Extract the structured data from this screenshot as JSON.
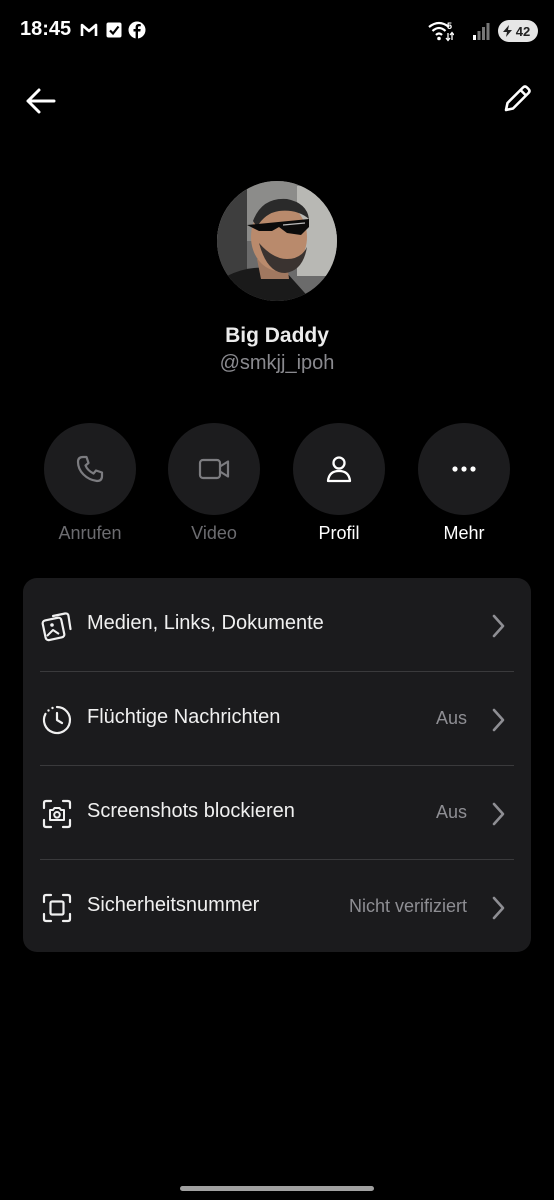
{
  "status_bar": {
    "time": "18:45",
    "battery": "42",
    "network": "5"
  },
  "contact": {
    "name": "Big Daddy",
    "handle": "@smkjj_ipoh"
  },
  "actions": [
    {
      "label": "Anrufen",
      "enabled": false,
      "icon": "phone-icon"
    },
    {
      "label": "Video",
      "enabled": false,
      "icon": "video-icon"
    },
    {
      "label": "Profil",
      "enabled": true,
      "icon": "person-icon"
    },
    {
      "label": "Mehr",
      "enabled": true,
      "icon": "more-icon"
    }
  ],
  "settings": [
    {
      "label": "Medien, Links, Dokumente",
      "value": "",
      "icon": "media-gallery-icon"
    },
    {
      "label": "Flüchtige Nachrichten",
      "value": "Aus",
      "icon": "timer-icon"
    },
    {
      "label": "Screenshots blockieren",
      "value": "Aus",
      "icon": "screenshot-camera-icon"
    },
    {
      "label": "Sicherheitsnummer",
      "value": "Nicht verifiziert",
      "icon": "safety-number-icon"
    }
  ],
  "colors": {
    "background": "#000000",
    "card": "#1b1b1d",
    "action_circle": "#1c1c1e",
    "secondary_text": "#8e8e93",
    "disabled_text": "#6c6c70"
  }
}
